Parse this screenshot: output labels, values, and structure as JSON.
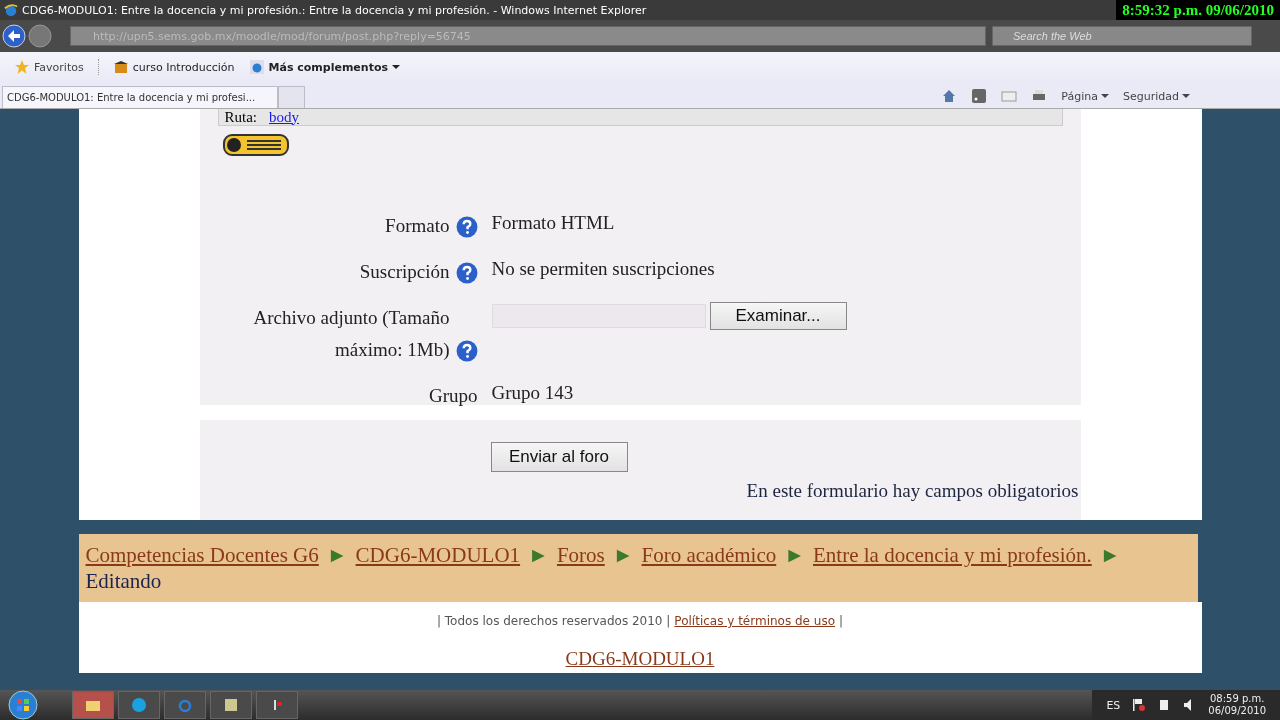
{
  "window": {
    "title": "CDG6-MODULO1: Entre la docencia y mi profesión.: Entre la docencia y mi profesión. - Windows Internet Explorer"
  },
  "clock": "8:59:32 p.m. 09/06/2010",
  "address_bar": {
    "value": "http://upn5.sems.gob.mx/moodle/mod/forum/post.php?reply=56745"
  },
  "search": {
    "placeholder": "Search the Web"
  },
  "favorites_bar": [
    {
      "label": "Favoritos",
      "kind": "favorites"
    },
    {
      "label": "curso Introducción",
      "kind": "site"
    },
    {
      "label": "Más complementos",
      "kind": "addons"
    }
  ],
  "tabs": [
    {
      "label": "CDG6-MODULO1: Entre la docencia y mi profesi...",
      "selected": true
    },
    {
      "selected": false
    }
  ],
  "command_bar": [
    "Página",
    "Seguridad"
  ],
  "editor_path": {
    "label": "Ruta:",
    "link": "body"
  },
  "form_rows": [
    {
      "label": "Formato",
      "help": true,
      "kind": "text",
      "value": "Formato HTML"
    },
    {
      "label": "Suscripción",
      "help": true,
      "kind": "text",
      "value": "No se permiten suscripciones"
    },
    {
      "label": "Archivo adjunto (Tamaño máximo: 1Mb)",
      "help": true,
      "kind": "file",
      "button": "Examinar..."
    },
    {
      "label": "Grupo",
      "help": false,
      "kind": "text",
      "value": "Grupo 143"
    }
  ],
  "submit_button": "Enviar al foro",
  "required_note": "En este formulario hay campos obligatorios",
  "breadcrumb": {
    "links": [
      "Competencias Docentes G6",
      "CDG6-MODULO1",
      "Foros",
      "Foro académico",
      "Entre la docencia y mi profesión."
    ],
    "separator": "►",
    "current": "Editando"
  },
  "footer": {
    "text": "| Todos los derechos reservados 2010 |",
    "link": "Políticas y términos de uso",
    "end": "|",
    "course_link": "CDG6-MODULO1"
  },
  "taskbar": {
    "language": "ES",
    "time": "08:59 p.m.",
    "date": "06/09/2010"
  }
}
